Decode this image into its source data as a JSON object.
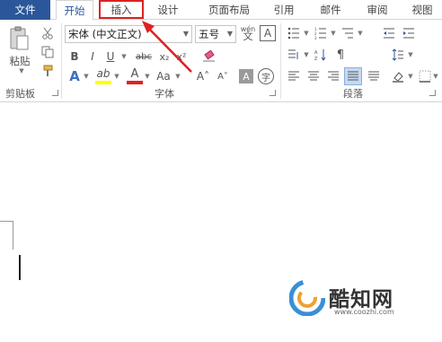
{
  "tabs": {
    "file": "文件",
    "home": "开始",
    "insert": "插入",
    "design": "设计",
    "layout": "页面布局",
    "references": "引用",
    "mailings": "邮件",
    "review": "审阅",
    "view": "视图"
  },
  "clipboard": {
    "paste_label": "粘贴",
    "group_label": "剪贴板"
  },
  "font": {
    "font_name": "宋体 (中文正文)",
    "font_size": "五号",
    "group_label": "字体",
    "bold": "B",
    "italic": "I",
    "underline": "U",
    "strike": "abc",
    "subscript": "x₂",
    "superscript": "x²",
    "text_effects": "A",
    "highlight": "ab",
    "font_color": "A",
    "change_case": "Aa",
    "grow": "A˄",
    "shrink": "A˅",
    "char_shading": "A",
    "enclose_char": "字",
    "phonetic": "wén",
    "char_border": "A"
  },
  "paragraph": {
    "group_label": "段落"
  },
  "watermark": {
    "brand": "酷知网",
    "url": "www.coozhi.com"
  },
  "colors": {
    "file_tab": "#2b579a",
    "highlight_bar": "#ffff00",
    "font_color_bar": "#e02020",
    "red_callout": "#e02020"
  }
}
